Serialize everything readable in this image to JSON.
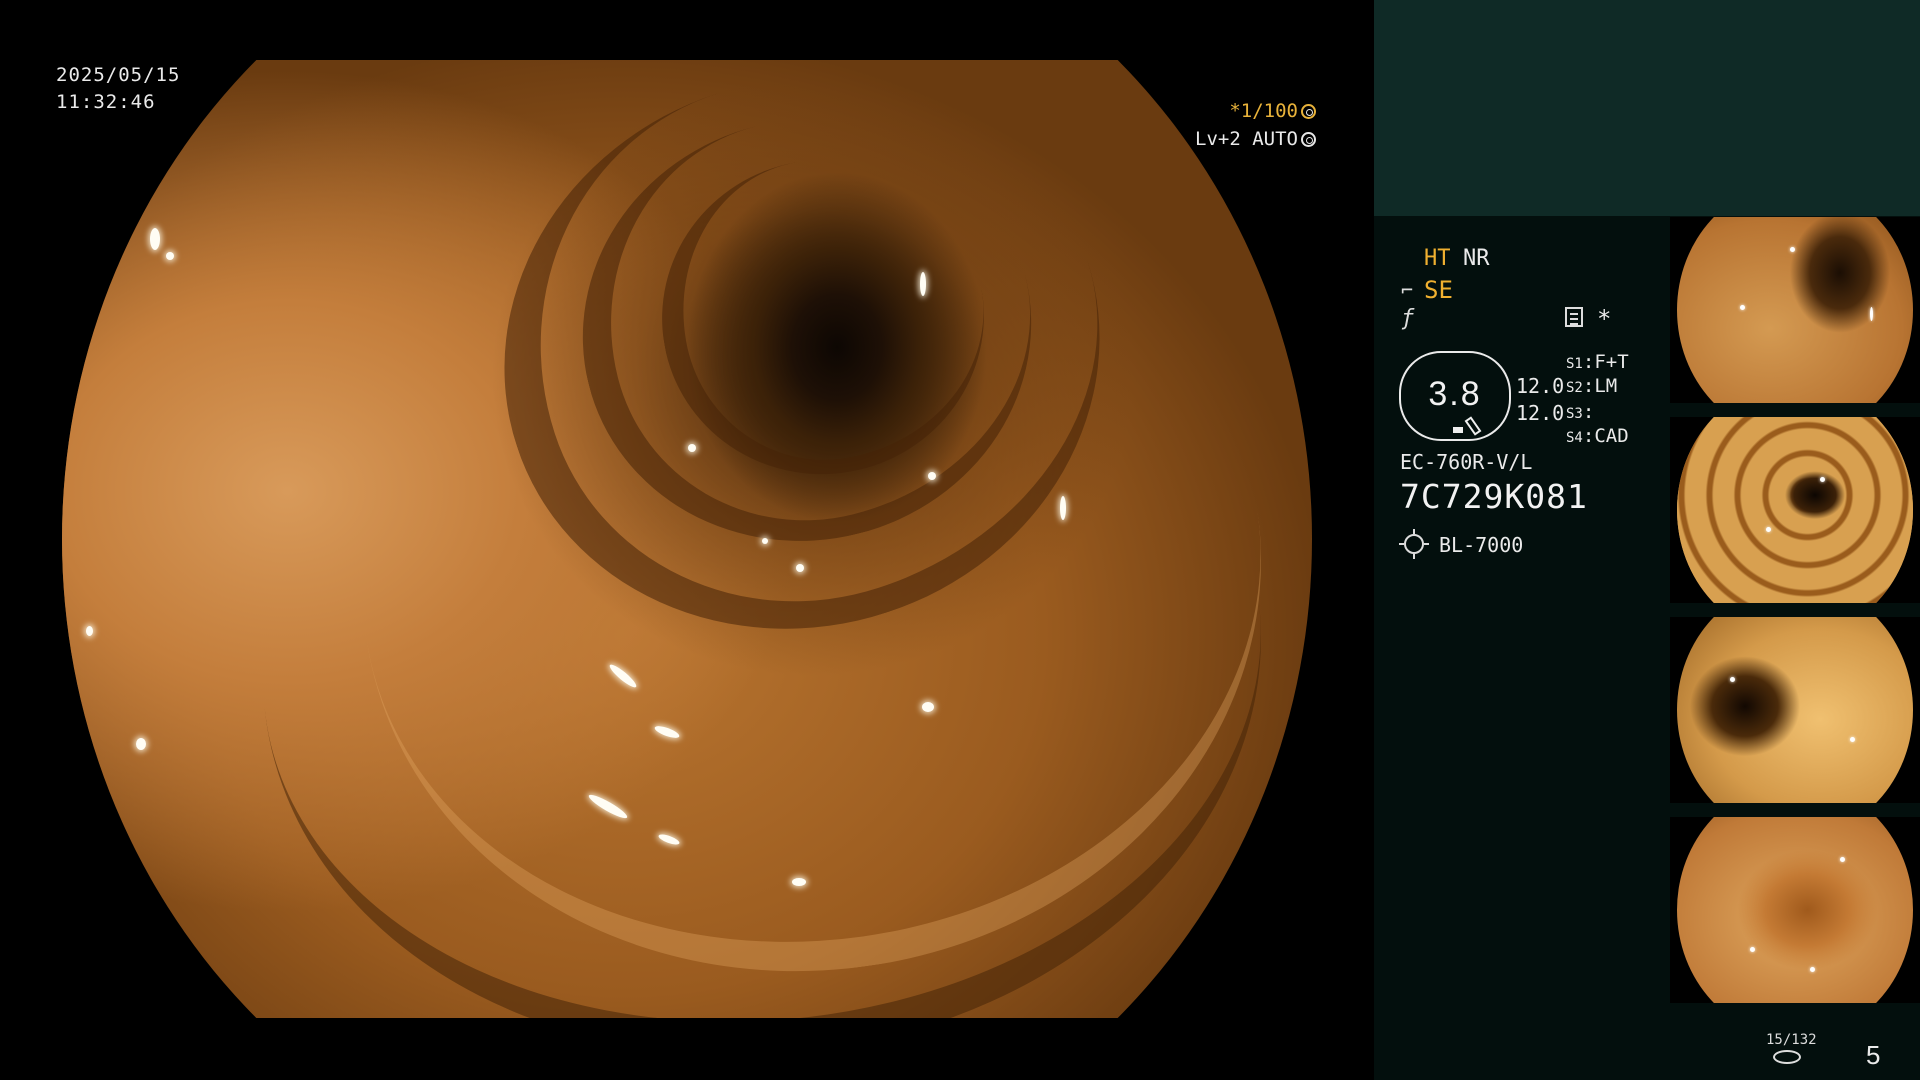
{
  "overlay": {
    "date": "2025/05/15",
    "time": "11:32:46",
    "shutter": "*1/100",
    "level": "Lv+2 AUTO"
  },
  "status": {
    "ht": "HT",
    "nr": "NR",
    "se": "SE",
    "gauge_value": "3.8",
    "value_1": "12.0",
    "value_2": "12.0",
    "slots": [
      {
        "key": "S1",
        "value": "F+T"
      },
      {
        "key": "S2",
        "value": "LM"
      },
      {
        "key": "S3",
        "value": ""
      },
      {
        "key": "S4",
        "value": "CAD"
      }
    ],
    "scope_model": "EC-760R-V/L",
    "scope_serial": "7C729K081",
    "light_source": "BL-7000",
    "accent_color": "#f0b030",
    "panel_color": "#0f2a26"
  },
  "capture": {
    "counter": "15/132",
    "page": "5"
  }
}
